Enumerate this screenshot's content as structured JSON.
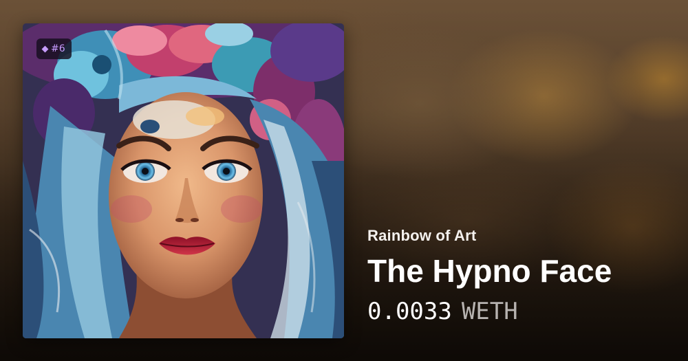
{
  "token": {
    "number": "#6"
  },
  "collection": {
    "name": "Rainbow of Art"
  },
  "item": {
    "title": "The Hypno Face"
  },
  "price": {
    "amount": "0.0033",
    "currency": "WETH"
  },
  "artwork": {
    "subject": "painted portrait of a woman with blue hair and flower crown",
    "colors": {
      "hair_blue": "#5fa3c9",
      "flowers_magenta": "#c84a7a",
      "flowers_purple": "#6b3a8e",
      "skin": "#e3a57a",
      "lips": "#b81e35",
      "eyes": "#4ea6d8"
    }
  },
  "icons": {
    "badge": "diamond-icon"
  },
  "colors": {
    "badge_accent": "#c79cff",
    "title": "#ffffff",
    "currency": "#b7b3b0"
  }
}
